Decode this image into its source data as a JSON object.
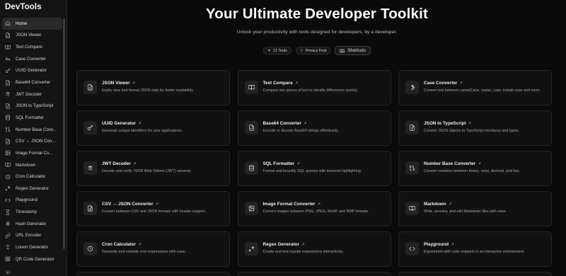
{
  "app": {
    "title": "DevTools"
  },
  "sidebar": {
    "items": [
      {
        "label": "Home",
        "icon": "home-icon",
        "active": true
      },
      {
        "label": "JSON Viewer",
        "icon": "file-json-icon"
      },
      {
        "label": "Text Compare",
        "icon": "book-open-icon"
      },
      {
        "label": "Case Converter",
        "icon": "case-icon"
      },
      {
        "label": "UUID Generator",
        "icon": "key-icon"
      },
      {
        "label": "Base64 Converter",
        "icon": "file-code-icon"
      },
      {
        "label": "JWT Decoder",
        "icon": "fingerprint-icon"
      },
      {
        "label": "JSON to TypeScript",
        "icon": "file-type-icon"
      },
      {
        "label": "SQL Formatter",
        "icon": "database-icon"
      },
      {
        "label": "Number Base Conv...",
        "icon": "binary-icon"
      },
      {
        "label": "CSV ↔ JSON Conve...",
        "icon": "file-text-icon"
      },
      {
        "label": "Image Format Co...",
        "icon": "image-icon"
      },
      {
        "label": "Markdown",
        "icon": "book-icon"
      },
      {
        "label": "Cron Calculator",
        "icon": "clock-icon"
      },
      {
        "label": "Regex Generator",
        "icon": "regex-icon"
      },
      {
        "label": "Playground",
        "icon": "code-icon"
      },
      {
        "label": "Timestamp",
        "icon": "hourglass-icon"
      },
      {
        "label": "Hash Generator",
        "icon": "hash-icon"
      },
      {
        "label": "URL Encoder",
        "icon": "link-icon"
      },
      {
        "label": "Lorem Generator",
        "icon": "text-icon"
      },
      {
        "label": "QR Code Generator",
        "icon": "qr-icon"
      }
    ]
  },
  "hero": {
    "title": "Your Ultimate Developer Toolkit",
    "subtitle": "Unlock your productivity with tools designed for developers, by a developer.",
    "badge_tools": "21 Tools",
    "badge_privacy": "Privacy First",
    "shortcuts_label": "Shortcuts"
  },
  "tools": [
    {
      "title": "JSON Viewer",
      "desc": "Easily view and format JSON data for better readability.",
      "icon": "file-json-icon"
    },
    {
      "title": "Text Compare",
      "desc": "Compare two pieces of text to identify differences quickly.",
      "icon": "book-open-icon"
    },
    {
      "title": "Case Converter",
      "desc": "Convert text between camelCase, snake_case, kebab-case and more.",
      "icon": "wrench-icon"
    },
    {
      "title": "UUID Generator",
      "desc": "Generate unique identifiers for your applications.",
      "icon": "key-icon"
    },
    {
      "title": "Base64 Converter",
      "desc": "Encode or decode Base64 strings effortlessly.",
      "icon": "file-code-icon"
    },
    {
      "title": "JSON to TypeScript",
      "desc": "Convert JSON objects to TypeScript interfaces and types.",
      "icon": "file-type-icon"
    },
    {
      "title": "JWT Decoder",
      "desc": "Decode and verify JSON Web Tokens (JWT) securely.",
      "icon": "fingerprint-icon"
    },
    {
      "title": "SQL Formatter",
      "desc": "Format and beautify SQL queries with keyword highlighting.",
      "icon": "database-icon"
    },
    {
      "title": "Number Base Converter",
      "desc": "Convert numbers between binary, octal, decimal, and hex.",
      "icon": "binary-icon"
    },
    {
      "title": "CSV ↔ JSON Converter",
      "desc": "Convert between CSV and JSON formats with header support.",
      "icon": "file-text-icon"
    },
    {
      "title": "Image Format Converter",
      "desc": "Convert images between PNG, JPEG, WebP, and BMP formats.",
      "icon": "image-icon"
    },
    {
      "title": "Markdown",
      "desc": "Write, preview, and edit Markdown files with ease.",
      "icon": "book-icon"
    },
    {
      "title": "Cron Calculator",
      "desc": "Generate and validate cron expressions with ease.",
      "icon": "clock-icon"
    },
    {
      "title": "Regex Generator",
      "desc": "Create and test regular expressions interactively.",
      "icon": "regex-icon"
    },
    {
      "title": "Playground",
      "desc": "Experiment with code snippets in an interactive environment.",
      "icon": "code-icon"
    }
  ],
  "colors": {
    "background": "#0a0a0a",
    "sidebar": "#141414",
    "card": "#111111",
    "border": "#262626",
    "active": "#2a2a2a"
  }
}
